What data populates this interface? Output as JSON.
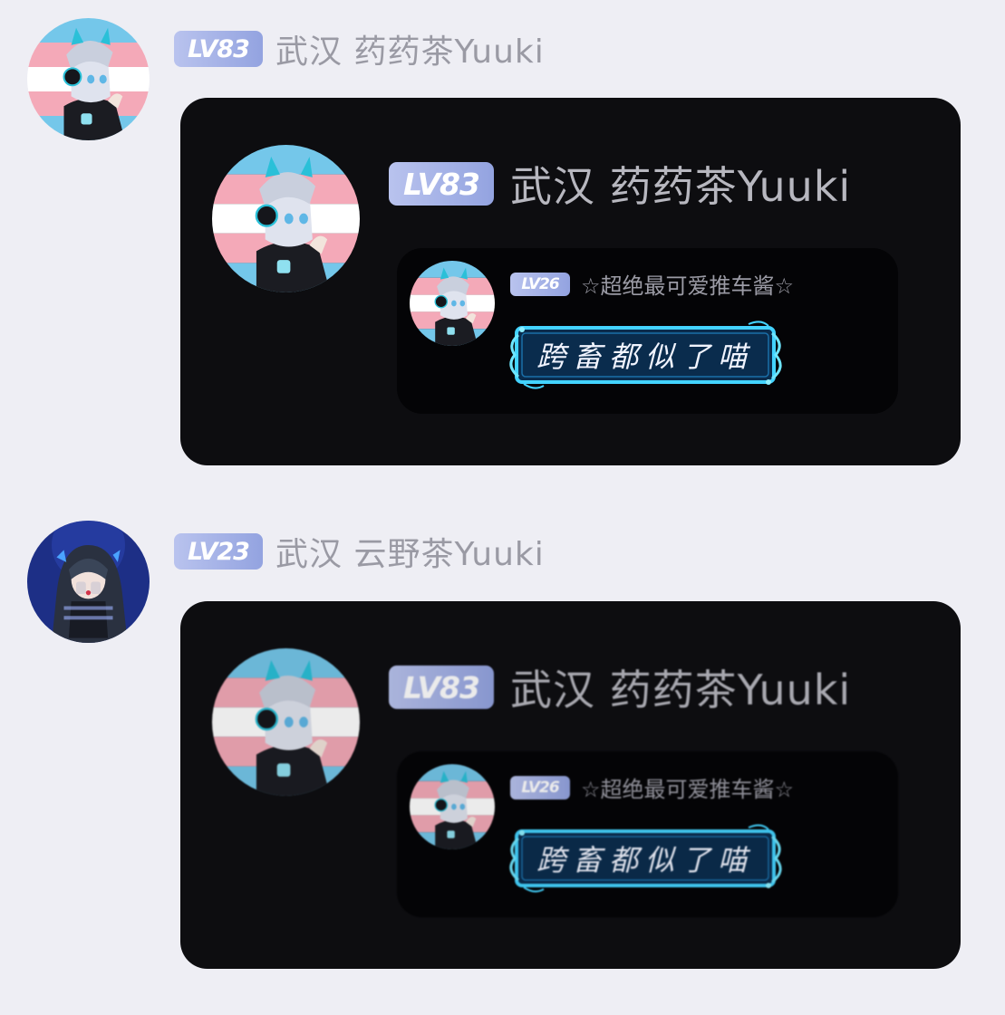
{
  "messages": [
    {
      "sender": {
        "level": "LV83",
        "name": "武汉 药药茶Yuuki",
        "avatar_icon": "avatar-white-hair-cat-headset-icon"
      },
      "quote": {
        "level": "LV83",
        "name": "武汉 药药茶Yuuki",
        "inner": {
          "level": "LV26",
          "name": "☆超绝最可爱推车酱☆",
          "badge_text": "跨畜都似了喵"
        }
      }
    },
    {
      "sender": {
        "level": "LV23",
        "name": "武汉  云野茶Yuuki",
        "avatar_icon": "avatar-dark-hair-blue-icon"
      },
      "quote": {
        "level": "LV83",
        "name": "武汉 药药茶Yuuki",
        "inner": {
          "level": "LV26",
          "name": "☆超绝最可爱推车酱☆",
          "badge_text": "跨畜都似了喵"
        }
      }
    }
  ],
  "colors": {
    "page_bg": "#eeeef4",
    "bubble_bg": "#0d0d10",
    "level_badge": "#a6b2e8",
    "flag_blue": "#74c7ea",
    "flag_pink": "#f4a9b8",
    "badge_glow": "#3fd3ff"
  }
}
